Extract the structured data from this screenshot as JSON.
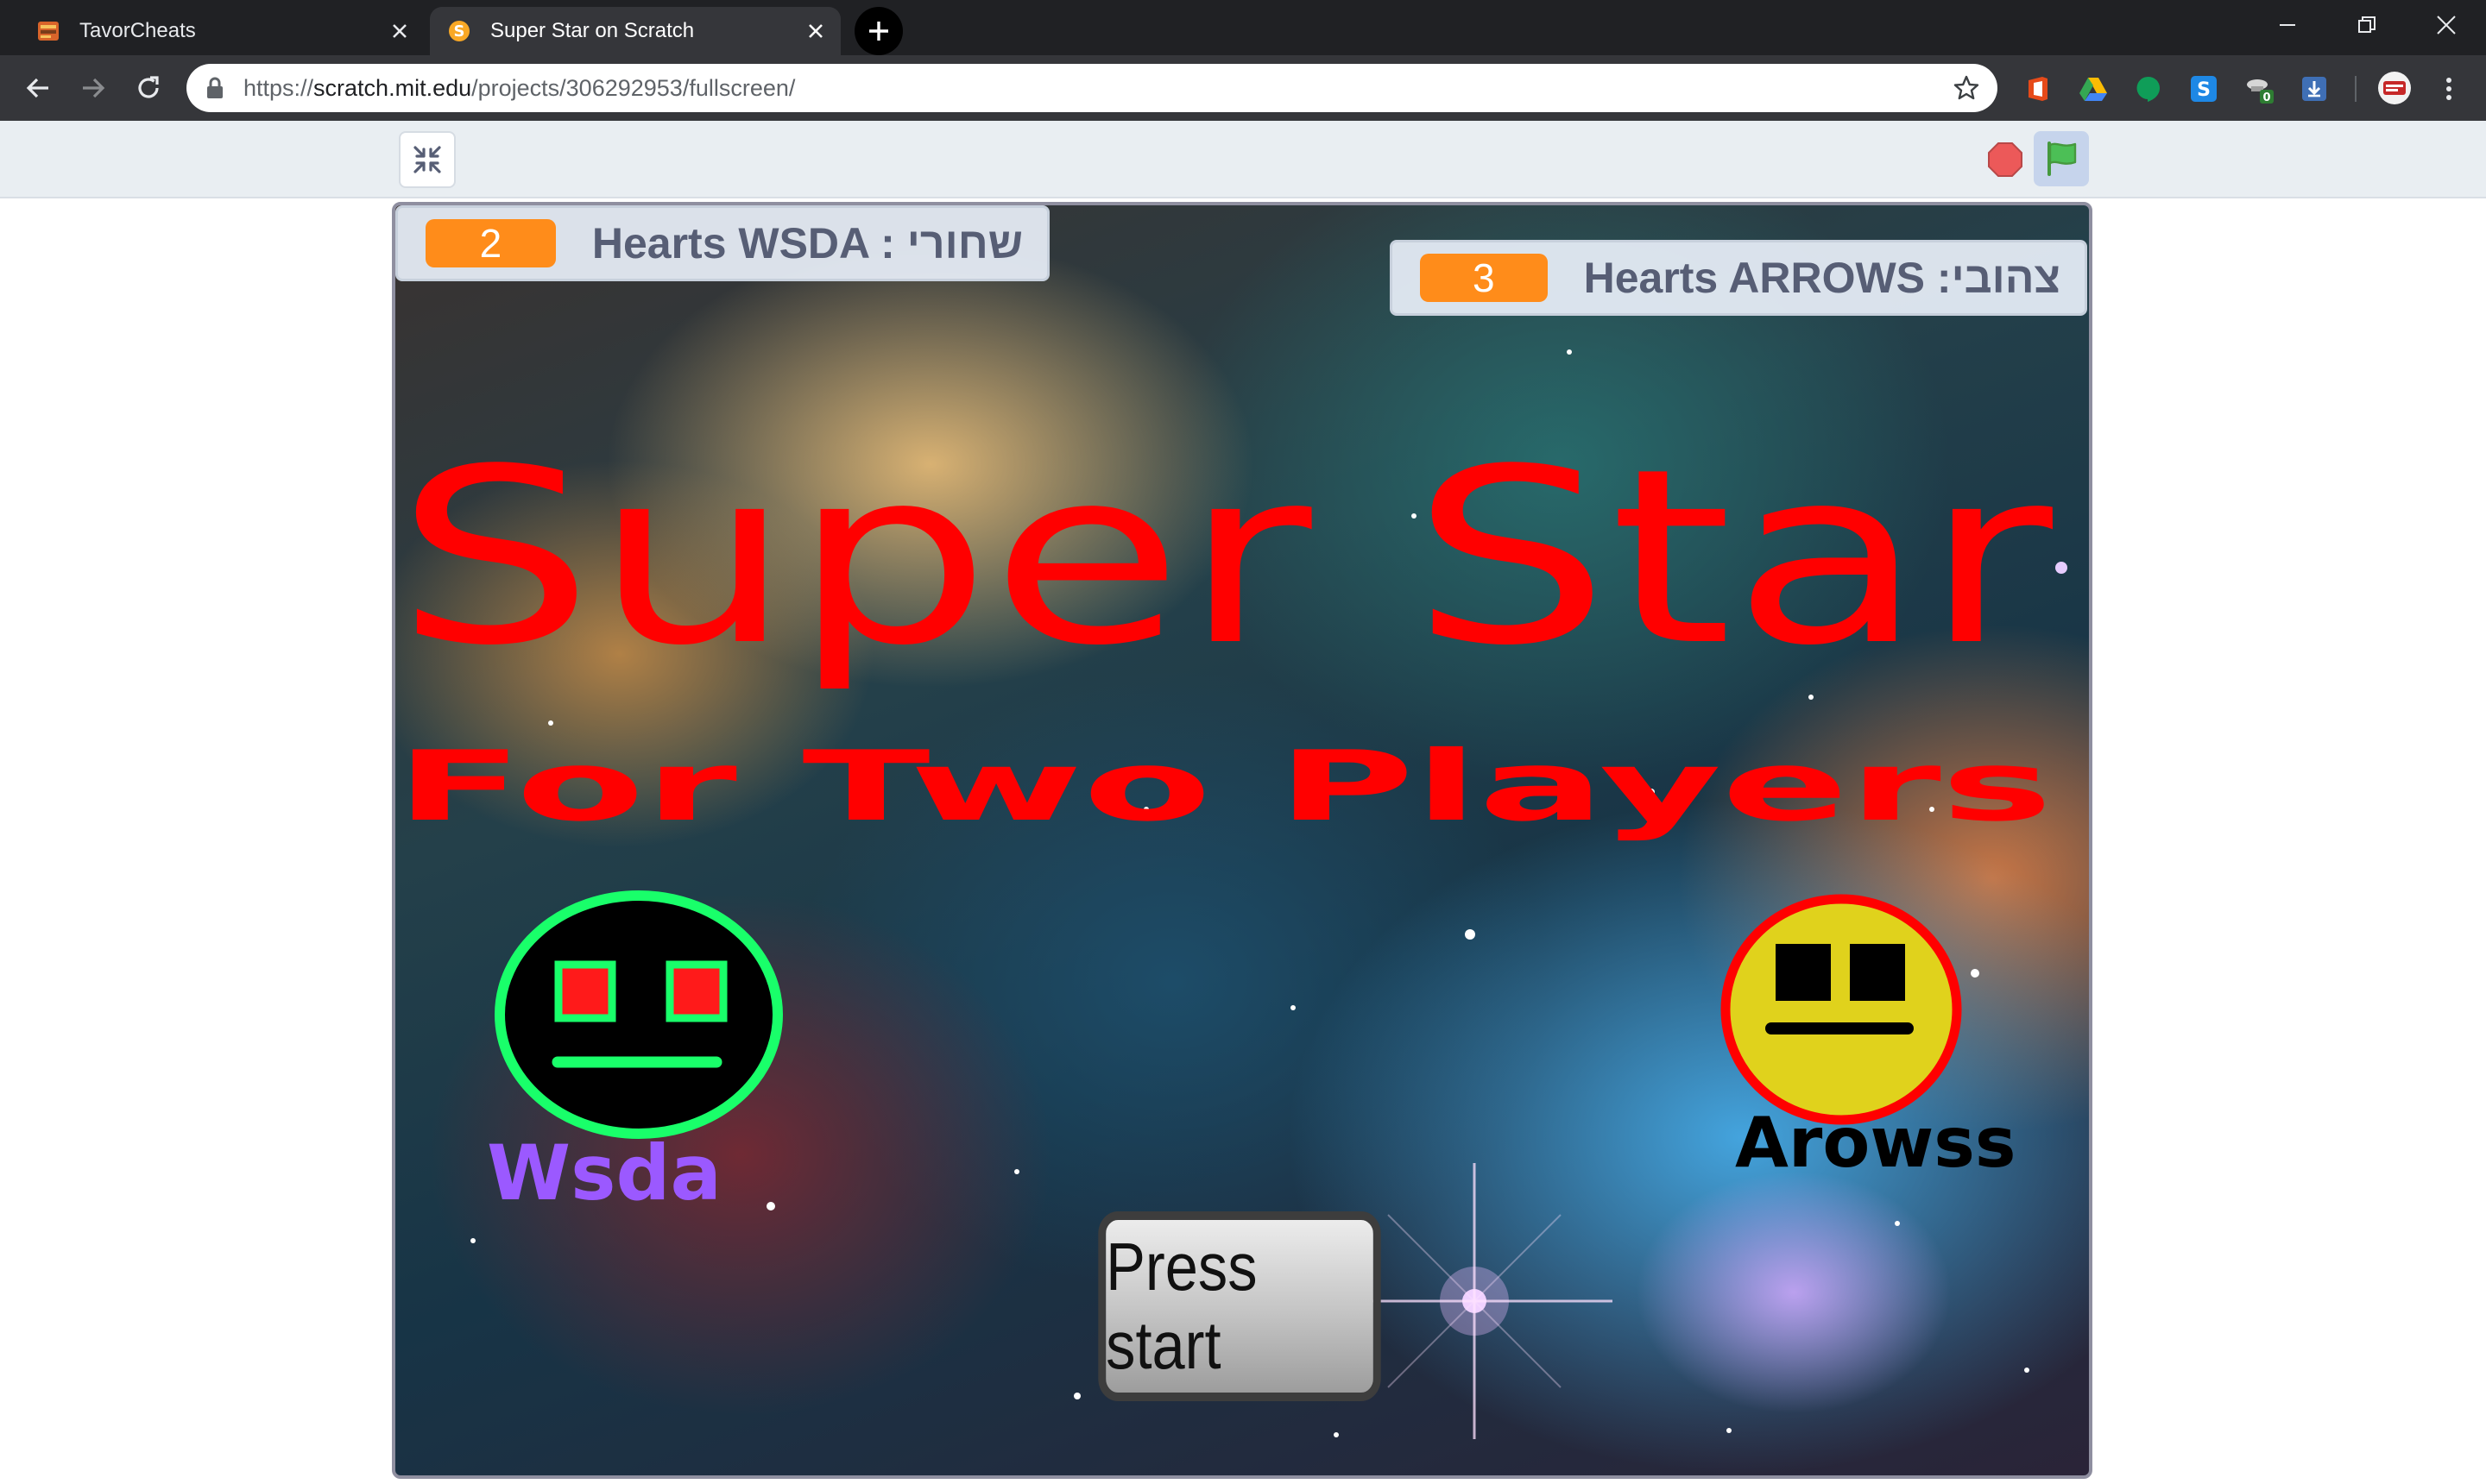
{
  "browser": {
    "tabs": [
      {
        "title": "TavorCheats",
        "active": false
      },
      {
        "title": "Super Star on Scratch",
        "active": true
      }
    ],
    "url": {
      "scheme": "https://",
      "host": "scratch.mit.edu",
      "path": "/projects/306292953/fullscreen/"
    },
    "extension_badge": "0",
    "colors": {
      "frame": "#202124",
      "toolbar": "#35363a",
      "omnibox": "#ffffff"
    }
  },
  "scratch": {
    "controls": {
      "unfullscreen_icon": "shrink-icon",
      "stop_icon": "stop-sign-icon",
      "green_flag_icon": "green-flag-icon"
    },
    "monitors": [
      {
        "label": "Hearts WSDA : שחורי",
        "value": "2"
      },
      {
        "label": "Hearts ARROWS :צהובי",
        "value": "3"
      }
    ],
    "title": "Super Star",
    "subtitle": "For Two Players",
    "players": [
      {
        "name": "Wsda",
        "face_color": "#000000",
        "ring_color": "#19ff6a",
        "eye_color": "#ff1a1a"
      },
      {
        "name": "Arowss",
        "face_color": "#e0d21c",
        "ring_color": "#ff0000",
        "eye_color": "#000000"
      }
    ],
    "start_button": "Press start",
    "colors": {
      "title": "#ff0000",
      "monitor_value": "#ff8c1a",
      "monitor_label": "#575e75"
    }
  }
}
